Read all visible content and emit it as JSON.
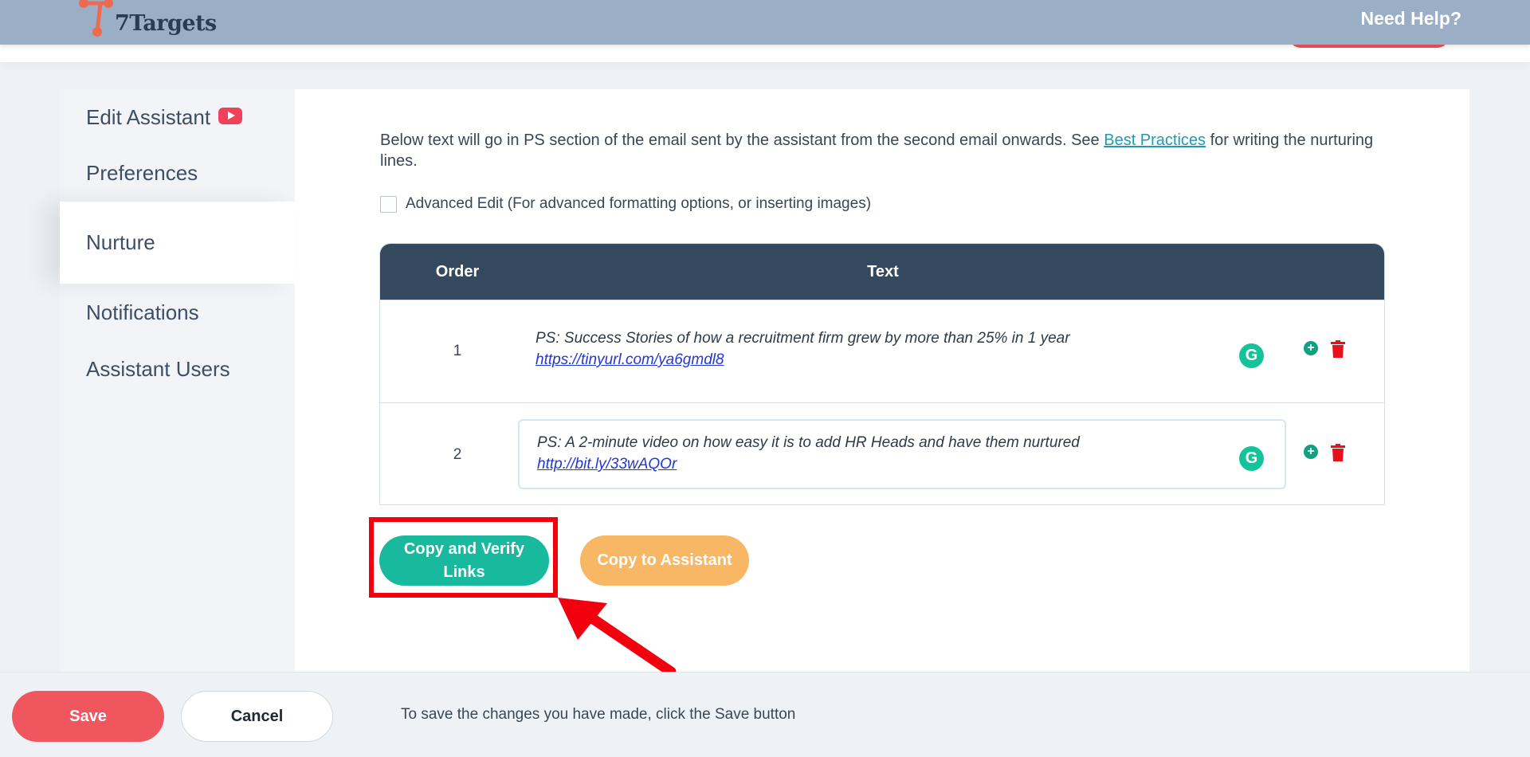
{
  "header": {
    "logo_text": "7Targets",
    "help_label": "Need Help?"
  },
  "sidebar": {
    "items": [
      {
        "label": "Edit Assistant"
      },
      {
        "label": "Preferences"
      },
      {
        "label": "Nurture"
      },
      {
        "label": "Notifications"
      },
      {
        "label": "Assistant Users"
      }
    ]
  },
  "main": {
    "description_before_link": "Below text will go in PS section of the email sent by the assistant from the second email onwards. See ",
    "best_practices_link": "Best Practices",
    "description_after_link": " for writing the nurturing lines.",
    "advanced_edit_label": "Advanced Edit (For advanced formatting options, or inserting images)",
    "table": {
      "headers": {
        "order": "Order",
        "text": "Text"
      },
      "rows": [
        {
          "order": "1",
          "text": "PS: Success Stories of how a recruitment firm grew by more than 25% in 1 year",
          "link": "https://tinyurl.com/ya6gmdl8"
        },
        {
          "order": "2",
          "text": "PS: A 2-minute video on how easy it is to add HR Heads and have them nurtured",
          "link": "http://bit.ly/33wAQOr"
        }
      ]
    },
    "copy_verify_label": "Copy and Verify Links",
    "copy_assistant_label": "Copy to Assistant"
  },
  "footer": {
    "save_label": "Save",
    "cancel_label": "Cancel",
    "message": "To save the changes you have made, click the Save button"
  },
  "colors": {
    "header_bg": "#9aaec6",
    "table_header_bg": "#34495e",
    "teal": "#19b99e",
    "orange": "#f8b765",
    "save_red": "#f0565e",
    "highlight_red": "#f2000e"
  }
}
